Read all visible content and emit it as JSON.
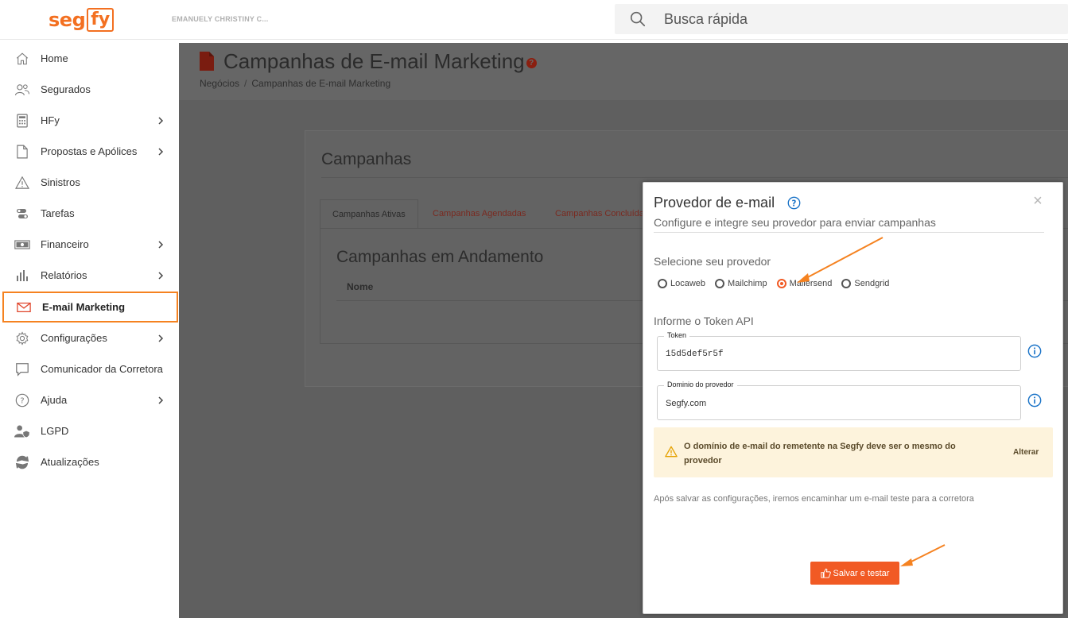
{
  "header": {
    "logo_seg": "seg",
    "logo_fy": "fy",
    "username": "EMANUELY CHRISTINY C...",
    "search_placeholder": "Busca rápida"
  },
  "sidebar": {
    "items": [
      {
        "label": "Home",
        "icon": "home-icon",
        "chevron": false
      },
      {
        "label": "Segurados",
        "icon": "users-icon",
        "chevron": false
      },
      {
        "label": "HFy",
        "icon": "calculator-icon",
        "chevron": true
      },
      {
        "label": "Propostas e Apólices",
        "icon": "document-icon",
        "chevron": true
      },
      {
        "label": "Sinistros",
        "icon": "warning-icon",
        "chevron": false
      },
      {
        "label": "Tarefas",
        "icon": "toggle-icon",
        "chevron": false
      },
      {
        "label": "Financeiro",
        "icon": "money-icon",
        "chevron": true
      },
      {
        "label": "Relatórios",
        "icon": "bar-chart-icon",
        "chevron": true
      },
      {
        "label": "E-mail Marketing",
        "icon": "envelope-icon",
        "chevron": false,
        "active": true
      },
      {
        "label": "Configurações",
        "icon": "gear-icon",
        "chevron": true
      },
      {
        "label": "Comunicador da Corretora",
        "icon": "chat-icon",
        "chevron": false
      },
      {
        "label": "Ajuda",
        "icon": "help-circle-icon",
        "chevron": true
      },
      {
        "label": "LGPD",
        "icon": "user-shield-icon",
        "chevron": false
      },
      {
        "label": "Atualizações",
        "icon": "refresh-icon",
        "chevron": false
      }
    ]
  },
  "page": {
    "title": "Campanhas de E-mail Marketing",
    "breadcrumb": [
      "Negócios",
      "Campanhas de E-mail Marketing"
    ],
    "card_title": "Campanhas",
    "tabs": [
      "Campanhas Ativas",
      "Campanhas Agendadas",
      "Campanhas Concluídas"
    ],
    "section_title": "Campanhas em Andamento",
    "table_columns": [
      "Nome"
    ]
  },
  "modal": {
    "title": "Provedor de e-mail",
    "subtitle": "Configure e integre seu provedor para enviar campanhas",
    "provider_label": "Selecione seu provedor",
    "providers": [
      "Locaweb",
      "Mailchimp",
      "Mailersend",
      "Sendgrid"
    ],
    "selected_provider": "Mailersend",
    "token_section": "Informe o Token API",
    "token_label": "Token",
    "token_value": "15d5def5r5f",
    "domain_label": "Dominio do provedor",
    "domain_value": "Segfy.com",
    "alert_text": "O domínio de e-mail do remetente na Segfy deve ser o mesmo do provedor",
    "alert_link": "Alterar",
    "after_save_text": "Após salvar as configurações, iremos encaminhar um e-mail teste para a corretora",
    "save_button": "Salvar e testar",
    "close_symbol": "×"
  },
  "colors": {
    "brand_orange": "#f37021",
    "button_orange": "#f15a24",
    "active_border": "#f58220",
    "info_blue": "#1a73c7",
    "alert_bg": "#fdf3dc"
  }
}
